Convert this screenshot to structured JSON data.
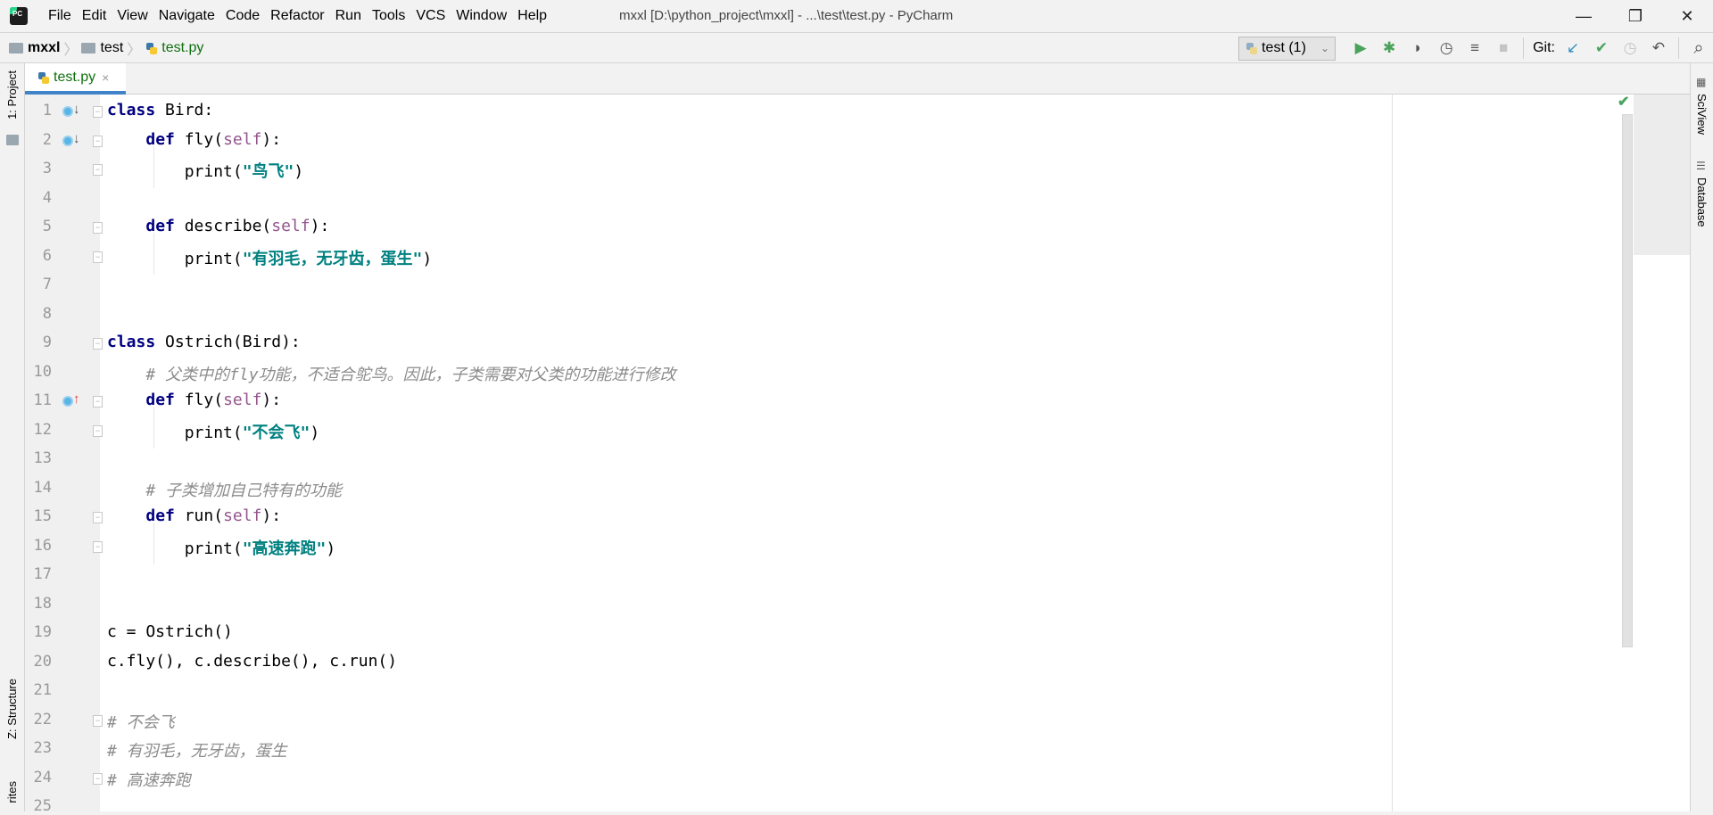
{
  "app": {
    "window_title": "mxxl [D:\\python_project\\mxxl] - ...\\test\\test.py - PyCharm",
    "logo_text": "PC"
  },
  "menu": [
    "File",
    "Edit",
    "View",
    "Navigate",
    "Code",
    "Refactor",
    "Run",
    "Tools",
    "VCS",
    "Window",
    "Help"
  ],
  "window_controls": {
    "minimize": "—",
    "maximize": "❐",
    "close": "✕"
  },
  "breadcrumb": {
    "project": "mxxl",
    "folder": "test",
    "file": "test.py"
  },
  "toolbar": {
    "run_config": "test (1)",
    "git_label": "Git:",
    "icons": {
      "run": "▶",
      "debug": "✱",
      "coverage": "◗",
      "profile": "◷",
      "concurrency": "≡",
      "stop": "■",
      "update": "↙",
      "commit": "✔",
      "history": "◷",
      "rollback": "↶",
      "search": "⌕"
    }
  },
  "tabs": [
    {
      "label": "test.py",
      "close": "×"
    }
  ],
  "side_tools": {
    "left": [
      "1: Project",
      "Z: Structure",
      "rites"
    ],
    "right": [
      "SciView",
      "Database"
    ]
  },
  "colors": {
    "keyword": "#000080",
    "self": "#94558d",
    "string": "#008080",
    "comment": "#8c8c8c",
    "accent": "#4083c9",
    "ok": "#4aa35a"
  },
  "editor": {
    "status_icon": "✔",
    "lines": [
      {
        "n": "1",
        "mark": "down",
        "fold": "open",
        "tokens": [
          {
            "t": "kw",
            "v": "class"
          },
          {
            "t": "",
            "v": " Bird:"
          }
        ]
      },
      {
        "n": "2",
        "mark": "down",
        "fold": "open",
        "tokens": [
          {
            "t": "",
            "v": "    "
          },
          {
            "t": "kw",
            "v": "def"
          },
          {
            "t": "",
            "v": " fly("
          },
          {
            "t": "self",
            "v": "self"
          },
          {
            "t": "",
            "v": "):"
          }
        ]
      },
      {
        "n": "3",
        "fold": "close",
        "tokens": [
          {
            "t": "",
            "v": "        print("
          },
          {
            "t": "str",
            "v": "\"鸟飞\""
          },
          {
            "t": "",
            "v": ")"
          }
        ]
      },
      {
        "n": "4",
        "tokens": []
      },
      {
        "n": "5",
        "fold": "open",
        "tokens": [
          {
            "t": "",
            "v": "    "
          },
          {
            "t": "kw",
            "v": "def"
          },
          {
            "t": "",
            "v": " describe("
          },
          {
            "t": "self",
            "v": "self"
          },
          {
            "t": "",
            "v": "):"
          }
        ]
      },
      {
        "n": "6",
        "fold": "close",
        "tokens": [
          {
            "t": "",
            "v": "        print("
          },
          {
            "t": "str",
            "v": "\"有羽毛，无牙齿，蛋生\""
          },
          {
            "t": "",
            "v": ")"
          }
        ]
      },
      {
        "n": "7",
        "tokens": []
      },
      {
        "n": "8",
        "tokens": []
      },
      {
        "n": "9",
        "fold": "open",
        "tokens": [
          {
            "t": "kw",
            "v": "class"
          },
          {
            "t": "",
            "v": " Ostrich(Bird):"
          }
        ]
      },
      {
        "n": "10",
        "tokens": [
          {
            "t": "",
            "v": "    "
          },
          {
            "t": "cm",
            "v": "# 父类中的fly功能，不适合鸵鸟。因此，子类需要对父类的功能进行修改"
          }
        ]
      },
      {
        "n": "11",
        "mark": "up",
        "fold": "open",
        "tokens": [
          {
            "t": "",
            "v": "    "
          },
          {
            "t": "kw",
            "v": "def"
          },
          {
            "t": "",
            "v": " fly("
          },
          {
            "t": "self",
            "v": "self"
          },
          {
            "t": "",
            "v": "):"
          }
        ]
      },
      {
        "n": "12",
        "fold": "close",
        "tokens": [
          {
            "t": "",
            "v": "        print("
          },
          {
            "t": "str",
            "v": "\"不会飞\""
          },
          {
            "t": "",
            "v": ")"
          }
        ]
      },
      {
        "n": "13",
        "tokens": []
      },
      {
        "n": "14",
        "tokens": [
          {
            "t": "",
            "v": "    "
          },
          {
            "t": "cm",
            "v": "# 子类增加自己特有的功能"
          }
        ]
      },
      {
        "n": "15",
        "fold": "open",
        "tokens": [
          {
            "t": "",
            "v": "    "
          },
          {
            "t": "kw",
            "v": "def"
          },
          {
            "t": "",
            "v": " run("
          },
          {
            "t": "self",
            "v": "self"
          },
          {
            "t": "",
            "v": "):"
          }
        ]
      },
      {
        "n": "16",
        "fold": "close",
        "tokens": [
          {
            "t": "",
            "v": "        print("
          },
          {
            "t": "str",
            "v": "\"高速奔跑\""
          },
          {
            "t": "",
            "v": ")"
          }
        ]
      },
      {
        "n": "17",
        "tokens": []
      },
      {
        "n": "18",
        "tokens": []
      },
      {
        "n": "19",
        "tokens": [
          {
            "t": "",
            "v": "c = Ostrich()"
          }
        ]
      },
      {
        "n": "20",
        "tokens": [
          {
            "t": "",
            "v": "c.fly(), c.describe(), c.run()"
          }
        ]
      },
      {
        "n": "21",
        "tokens": []
      },
      {
        "n": "22",
        "fold": "open",
        "tokens": [
          {
            "t": "cm",
            "v": "# 不会飞"
          }
        ]
      },
      {
        "n": "23",
        "tokens": [
          {
            "t": "cm",
            "v": "# 有羽毛，无牙齿，蛋生"
          }
        ]
      },
      {
        "n": "24",
        "fold": "close",
        "tokens": [
          {
            "t": "cm",
            "v": "# 高速奔跑"
          }
        ]
      },
      {
        "n": "25",
        "tokens": []
      }
    ]
  }
}
